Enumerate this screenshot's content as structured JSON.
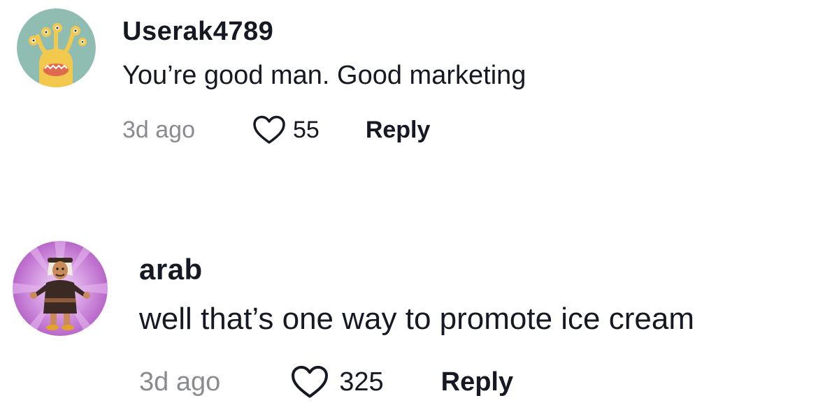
{
  "comments": [
    {
      "username": "Userak4789",
      "text": "You’re good man. Good marketing",
      "timestamp": "3d ago",
      "likes": "55",
      "reply_label": "Reply",
      "avatar": "monster-avatar",
      "avatar_bg": "#8fbdb2"
    },
    {
      "username": "arab",
      "text": "well that’s one way to promote ice cream",
      "timestamp": "3d ago",
      "likes": "325",
      "reply_label": "Reply",
      "avatar": "character-avatar",
      "avatar_bg": "#c77ad6"
    }
  ],
  "colors": {
    "text_primary": "#161823",
    "text_secondary": "#8a8b91",
    "background": "#ffffff"
  }
}
